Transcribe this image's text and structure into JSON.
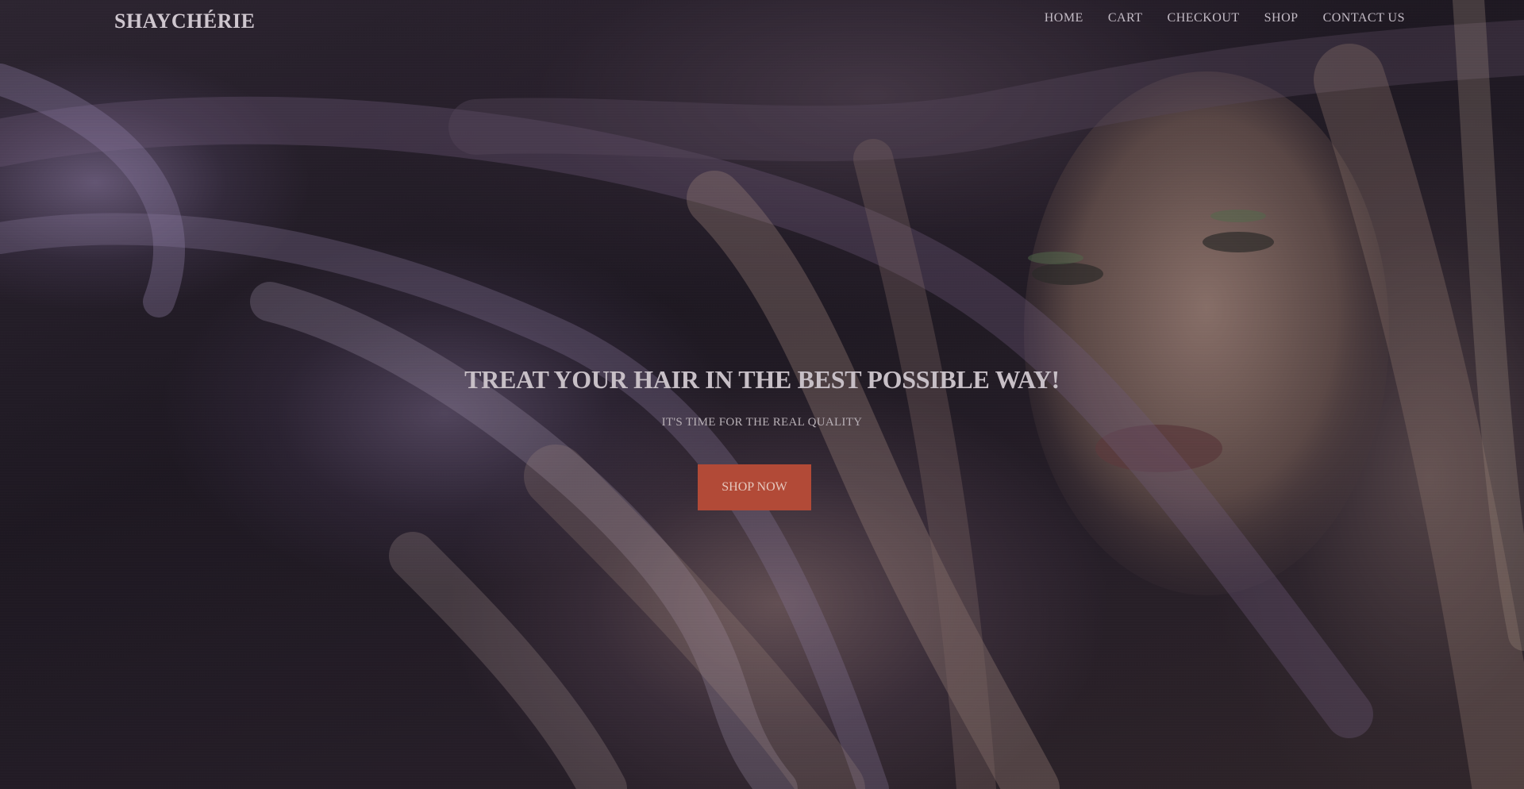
{
  "brand": {
    "logo": "SHAYCHÉRIE"
  },
  "nav": {
    "items": [
      {
        "label": "HOME"
      },
      {
        "label": "CART"
      },
      {
        "label": "CHECKOUT"
      },
      {
        "label": "SHOP"
      },
      {
        "label": "CONTACT US"
      }
    ]
  },
  "hero": {
    "headline": "TREAT YOUR HAIR IN THE BEST POSSIBLE WAY!",
    "subheadline": "IT'S TIME FOR THE REAL QUALITY",
    "cta_label": "SHOP NOW",
    "background_image": "woman-with-flowing-hair-photo"
  },
  "colors": {
    "cta_background": "#b24a37",
    "text": "#c7bfc6"
  }
}
